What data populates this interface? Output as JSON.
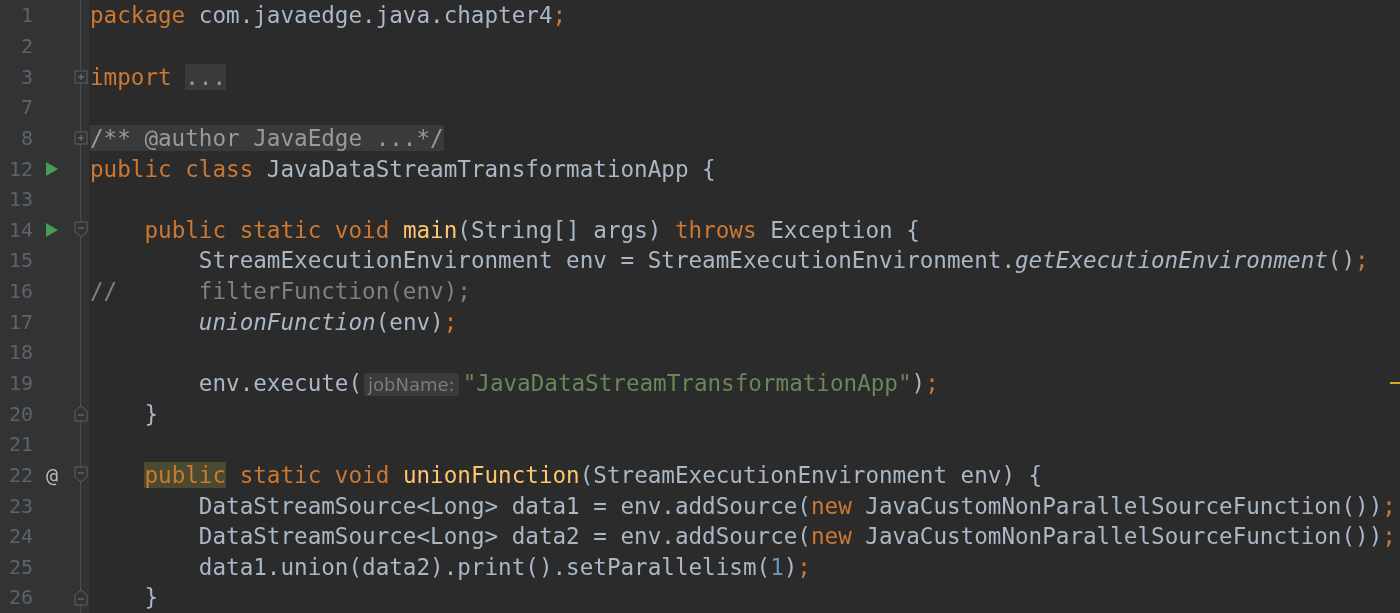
{
  "editor": {
    "lines": [
      {
        "number": "1",
        "tokens": [
          {
            "kind": "keyword",
            "t": "package"
          },
          {
            "kind": "plain",
            "t": " com.javaedge.java.chapter4"
          },
          {
            "kind": "keyword",
            "t": ";"
          }
        ]
      },
      {
        "number": "2"
      },
      {
        "number": "3",
        "fold": {
          "kind": "expand"
        },
        "tokens": [
          {
            "kind": "keyword",
            "t": "import "
          },
          {
            "kind": "folded",
            "t": "..."
          }
        ]
      },
      {
        "number": "7"
      },
      {
        "number": "8",
        "fold": {
          "kind": "expand"
        },
        "tokens": [
          {
            "kind": "folded",
            "t": "/** @author JavaEdge ...*/"
          }
        ]
      },
      {
        "number": "12",
        "marker": {
          "kind": "run"
        },
        "tokens": [
          {
            "kind": "keyword",
            "t": "public class"
          },
          {
            "kind": "plain",
            "t": " JavaDataStreamTransformationApp {"
          }
        ]
      },
      {
        "number": "13"
      },
      {
        "number": "14",
        "marker": {
          "kind": "run"
        },
        "fold": {
          "kind": "collapse"
        },
        "tokens": [
          {
            "kind": "keyword",
            "t": "    public static void "
          },
          {
            "kind": "declaration",
            "t": "main"
          },
          {
            "kind": "plain",
            "t": "(String[] args) "
          },
          {
            "kind": "keyword",
            "t": "throws"
          },
          {
            "kind": "plain",
            "t": " Exception {"
          }
        ]
      },
      {
        "number": "15",
        "tokens": [
          {
            "kind": "plain",
            "t": "        StreamExecutionEnvironment env = StreamExecutionEnvironment."
          },
          {
            "kind": "italic",
            "t": "getExecutionEnvironment"
          },
          {
            "kind": "plain",
            "t": "()"
          },
          {
            "kind": "keyword",
            "t": ";"
          }
        ]
      },
      {
        "number": "16",
        "tokens": [
          {
            "kind": "comment",
            "t": "//      filterFunction(env);"
          }
        ]
      },
      {
        "number": "17",
        "tokens": [
          {
            "kind": "italic",
            "t": "        unionFunction"
          },
          {
            "kind": "plain",
            "t": "(env)"
          },
          {
            "kind": "keyword",
            "t": ";"
          }
        ]
      },
      {
        "number": "18"
      },
      {
        "number": "19",
        "tokens": [
          {
            "kind": "plain",
            "t": "        env.execute("
          },
          {
            "kind": "hint",
            "t": "jobName:"
          },
          {
            "kind": "string",
            "t": "\"JavaDataStreamTransformationApp\""
          },
          {
            "kind": "plain",
            "t": ")"
          },
          {
            "kind": "keyword",
            "t": ";"
          }
        ]
      },
      {
        "number": "20",
        "fold": {
          "kind": "end"
        },
        "tokens": [
          {
            "kind": "plain",
            "t": "    }"
          }
        ]
      },
      {
        "number": "21"
      },
      {
        "number": "22",
        "marker": {
          "kind": "override",
          "text": "@"
        },
        "fold": {
          "kind": "collapse"
        },
        "tokens": [
          {
            "kind": "highlight",
            "t": "    public"
          },
          {
            "kind": "keyword",
            "t": " static void "
          },
          {
            "kind": "declaration",
            "t": "unionFunction"
          },
          {
            "kind": "plain",
            "t": "(StreamExecutionEnvironment env) {"
          }
        ]
      },
      {
        "number": "23",
        "tokens": [
          {
            "kind": "plain",
            "t": "        DataStreamSource<Long> data1 = env.addSource("
          },
          {
            "kind": "keyword",
            "t": "new"
          },
          {
            "kind": "plain",
            "t": " JavaCustomNonParallelSourceFunction())"
          },
          {
            "kind": "keyword",
            "t": ";"
          }
        ]
      },
      {
        "number": "24",
        "tokens": [
          {
            "kind": "plain",
            "t": "        DataStreamSource<Long> data2 = env.addSource("
          },
          {
            "kind": "keyword",
            "t": "new"
          },
          {
            "kind": "plain",
            "t": " JavaCustomNonParallelSourceFunction())"
          },
          {
            "kind": "keyword",
            "t": ";"
          }
        ]
      },
      {
        "number": "25",
        "tokens": [
          {
            "kind": "plain",
            "t": "        data1.union(data2).print().setParallelism("
          },
          {
            "kind": "number",
            "t": "1"
          },
          {
            "kind": "plain",
            "t": ")"
          },
          {
            "kind": "keyword",
            "t": ";"
          }
        ]
      },
      {
        "number": "26",
        "fold": {
          "kind": "end"
        },
        "tokens": [
          {
            "kind": "plain",
            "t": "    }"
          }
        ]
      }
    ]
  }
}
